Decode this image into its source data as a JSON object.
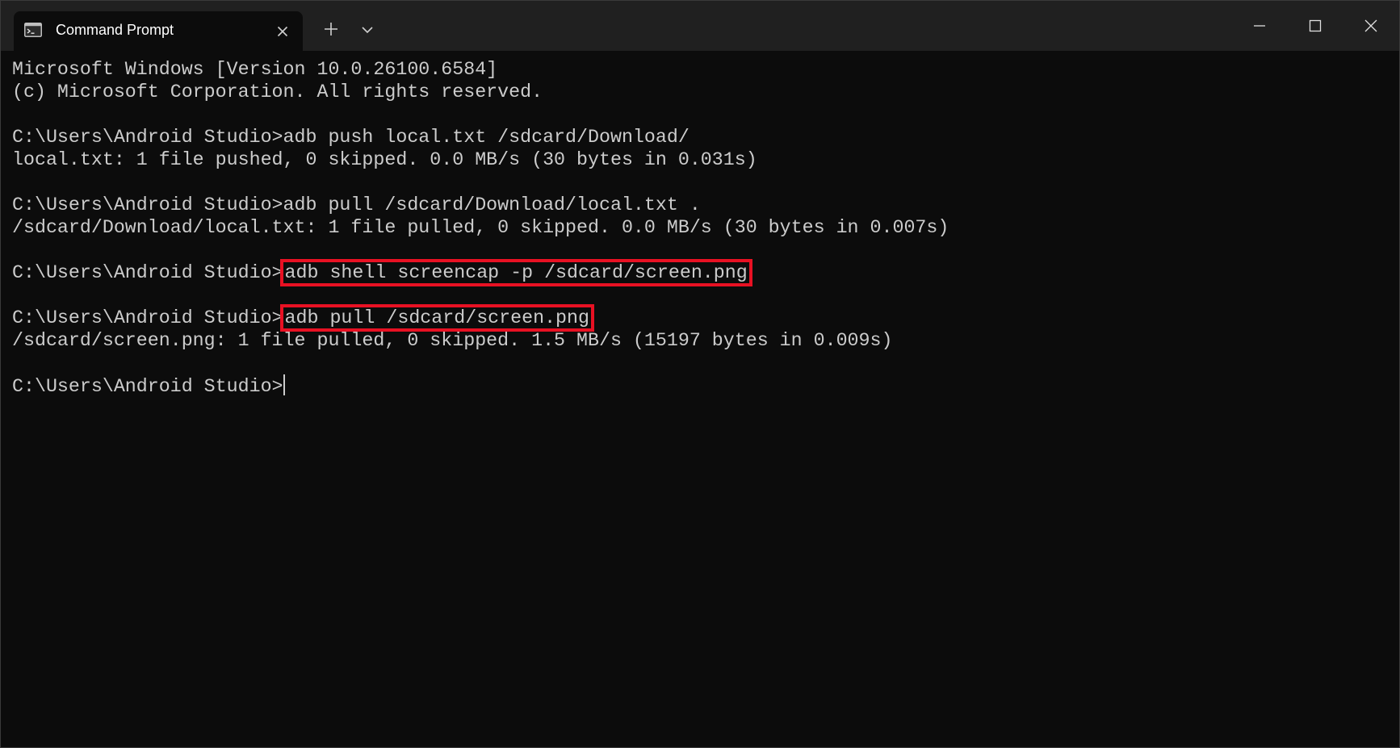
{
  "window": {
    "tab_title": "Command Prompt",
    "icons": {
      "tab": "terminal-icon",
      "close_tab": "close-icon",
      "new_tab": "plus-icon",
      "dropdown": "chevron-down-icon",
      "minimize": "minimize-icon",
      "maximize": "maximize-icon",
      "close_window": "close-icon"
    }
  },
  "colors": {
    "background": "#0c0c0c",
    "titlebar": "#202020",
    "text": "#cccccc",
    "highlight_box": "#e81123"
  },
  "console": {
    "lines": [
      {
        "text": "Microsoft Windows [Version 10.0.26100.6584]"
      },
      {
        "text": "(c) Microsoft Corporation. All rights reserved."
      },
      {
        "text": ""
      },
      {
        "prompt": "C:\\Users\\Android Studio>",
        "command": "adb push local.txt /sdcard/Download/"
      },
      {
        "text": "local.txt: 1 file pushed, 0 skipped. 0.0 MB/s (30 bytes in 0.031s)"
      },
      {
        "text": ""
      },
      {
        "prompt": "C:\\Users\\Android Studio>",
        "command": "adb pull /sdcard/Download/local.txt ."
      },
      {
        "text": "/sdcard/Download/local.txt: 1 file pulled, 0 skipped. 0.0 MB/s (30 bytes in 0.007s)"
      },
      {
        "text": ""
      },
      {
        "prompt": "C:\\Users\\Android Studio>",
        "command": "adb shell screencap -p /sdcard/screen.png",
        "highlighted": true
      },
      {
        "text": ""
      },
      {
        "prompt": "C:\\Users\\Android Studio>",
        "command": "adb pull /sdcard/screen.png",
        "highlighted": true
      },
      {
        "text": "/sdcard/screen.png: 1 file pulled, 0 skipped. 1.5 MB/s (15197 bytes in 0.009s)"
      },
      {
        "text": ""
      },
      {
        "prompt": "C:\\Users\\Android Studio>",
        "command": "",
        "cursor": true
      }
    ]
  }
}
